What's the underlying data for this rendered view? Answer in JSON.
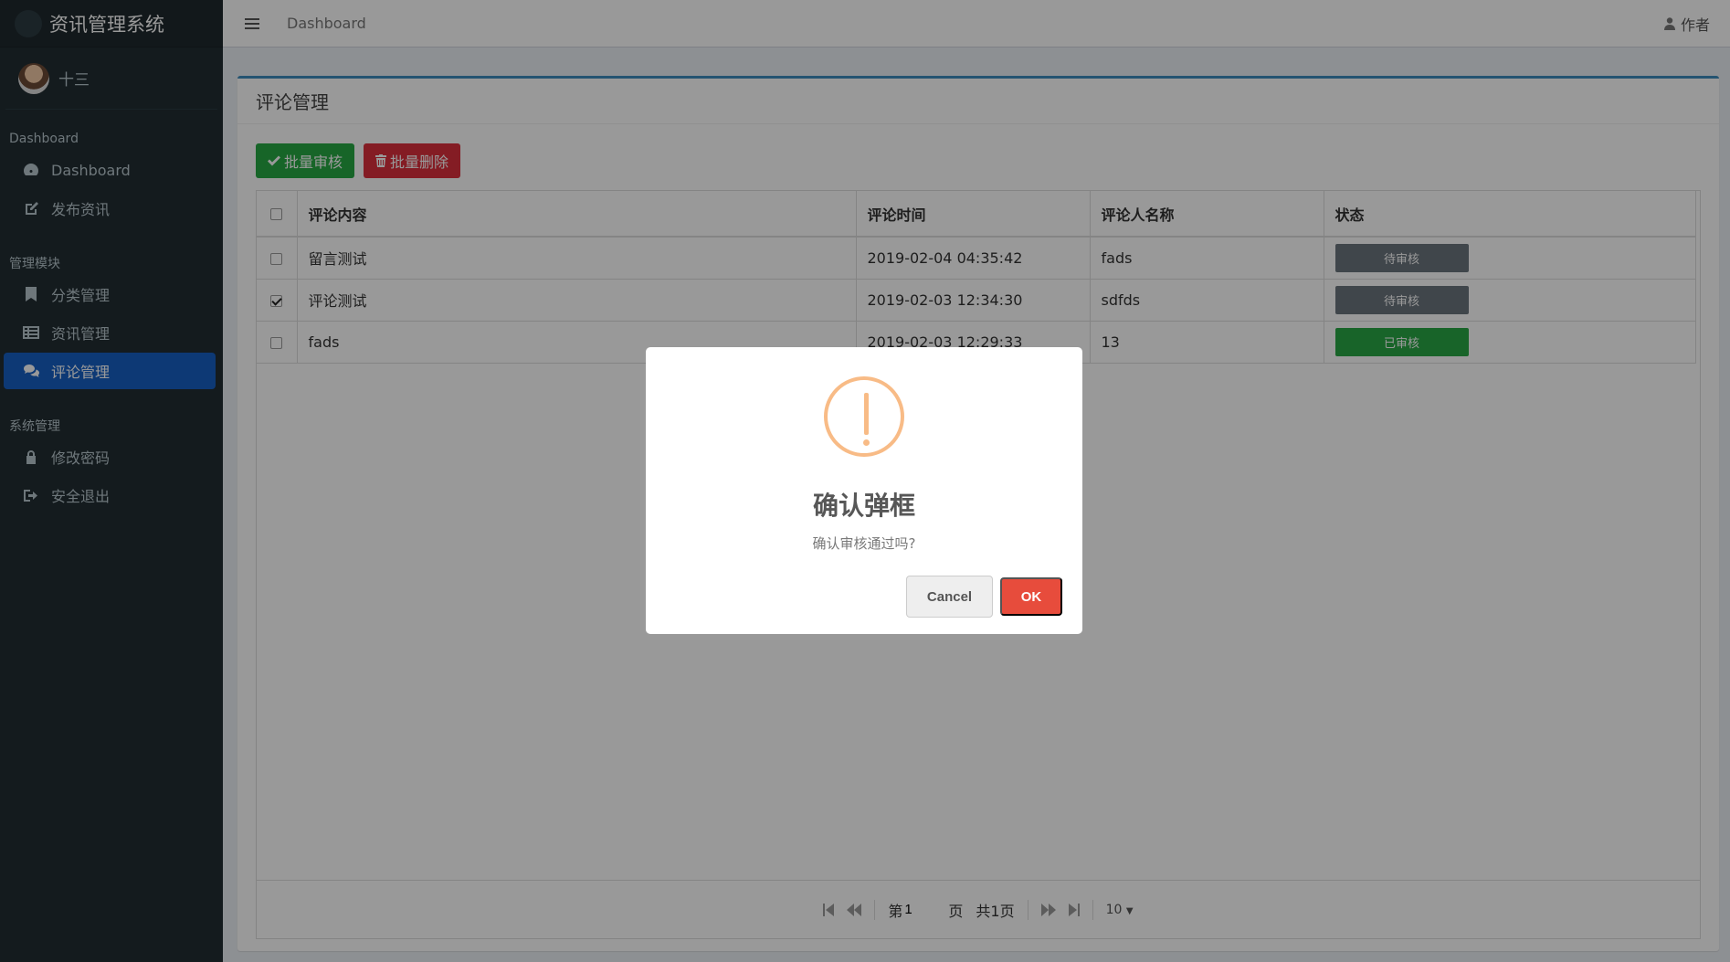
{
  "app": {
    "title": "资讯管理系统"
  },
  "user": {
    "name": "十三"
  },
  "sidebar": {
    "sections": [
      {
        "header": "Dashboard",
        "items": [
          {
            "label": "Dashboard",
            "icon": "dashboard-icon"
          },
          {
            "label": "发布资讯",
            "icon": "edit-icon"
          }
        ]
      },
      {
        "header": "管理模块",
        "items": [
          {
            "label": "分类管理",
            "icon": "bookmark-icon"
          },
          {
            "label": "资讯管理",
            "icon": "list-icon"
          },
          {
            "label": "评论管理",
            "icon": "comments-icon",
            "active": true
          }
        ]
      },
      {
        "header": "系统管理",
        "items": [
          {
            "label": "修改密码",
            "icon": "lock-icon"
          },
          {
            "label": "安全退出",
            "icon": "sign-out-icon"
          }
        ]
      }
    ]
  },
  "header": {
    "breadcrumb": "Dashboard",
    "user_label": "作者"
  },
  "main": {
    "title": "评论管理",
    "toolbar": {
      "approve_label": "批量审核",
      "delete_label": "批量删除"
    },
    "table": {
      "columns": [
        "评论内容",
        "评论时间",
        "评论人名称",
        "状态"
      ],
      "rows": [
        {
          "content": "留言测试",
          "time": "2019-02-04 04:35:42",
          "author": "fads",
          "status": "待审核",
          "checked": false
        },
        {
          "content": "评论测试",
          "time": "2019-02-03 12:34:30",
          "author": "sdfds",
          "status": "待审核",
          "checked": true
        },
        {
          "content": "fads",
          "time": "2019-02-03 12:29:33",
          "author": "13",
          "status": "已审核",
          "checked": false
        }
      ]
    },
    "pager": {
      "page_prefix": "第",
      "current_page": "1",
      "page_suffix": "页",
      "total": "共1页",
      "page_size": "10"
    }
  },
  "modal": {
    "title": "确认弹框",
    "text": "确认审核通过吗?",
    "cancel_label": "Cancel",
    "ok_label": "OK"
  },
  "colors": {
    "sidebar": "#222d32",
    "active": "#1660c4",
    "approve": "#27a844",
    "delete": "#dd2f3d",
    "pending": "#6c757d",
    "done": "#28a745",
    "ok": "#e74c3c",
    "warning": "#f8bb86"
  }
}
